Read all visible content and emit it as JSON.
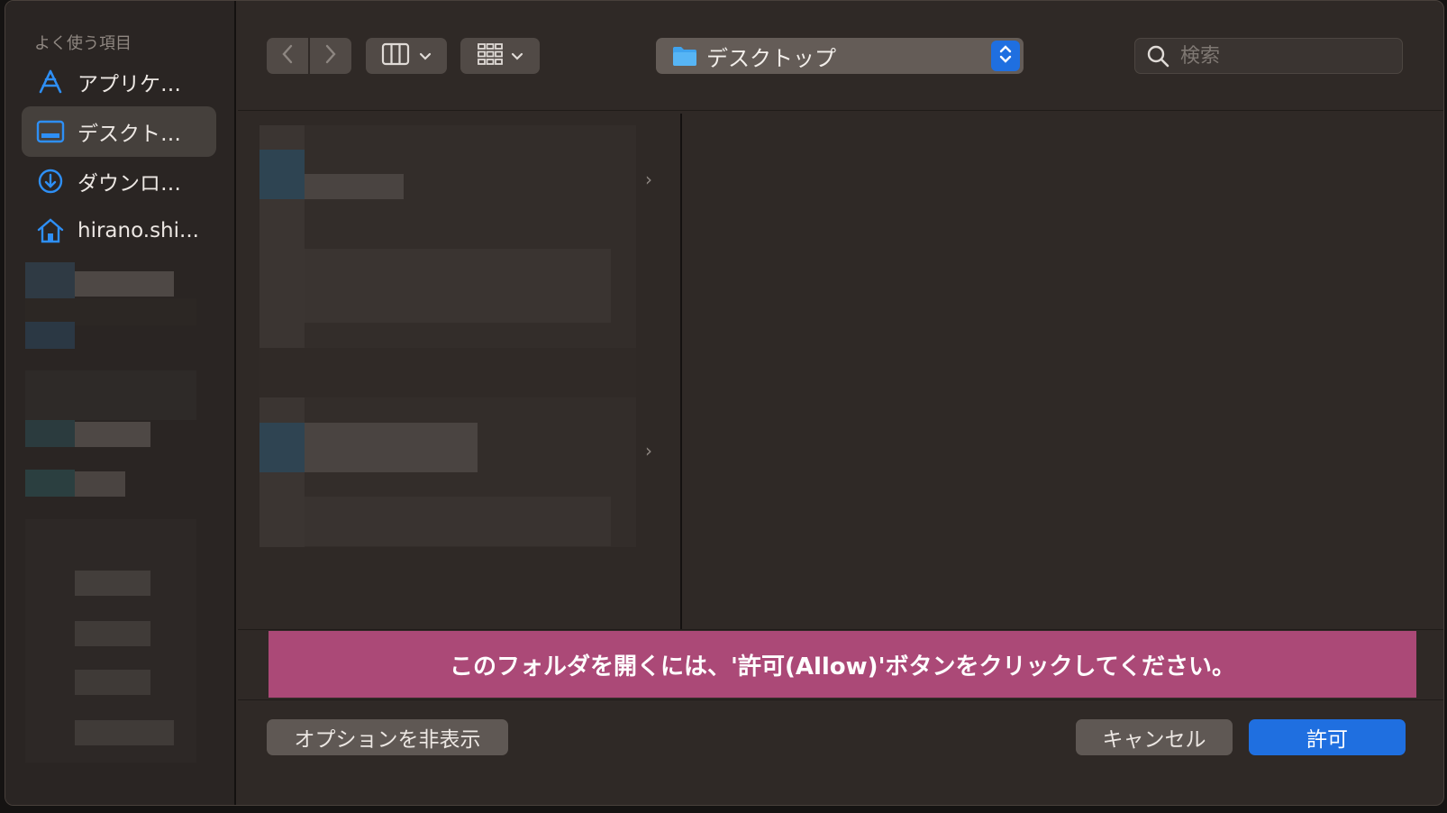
{
  "sidebar": {
    "heading": "よく使う項目",
    "items": [
      {
        "label": "アプリケ…",
        "icon": "applications-icon"
      },
      {
        "label": "デスクト…",
        "icon": "desktop-icon",
        "selected": true
      },
      {
        "label": "ダウンロ…",
        "icon": "downloads-icon"
      },
      {
        "label": "hirano.shi...",
        "icon": "home-icon"
      }
    ]
  },
  "toolbar": {
    "back_icon": "chevron-left-icon",
    "forward_icon": "chevron-right-icon",
    "view_icon": "column-view-icon",
    "group_icon": "grid-view-icon",
    "location": "デスクトップ",
    "search_placeholder": "検索"
  },
  "banner": {
    "message": "このフォルダを開くには、'許可(Allow)'ボタンをクリックしてください。"
  },
  "footer": {
    "options_label": "オプションを非表示",
    "cancel_label": "キャンセル",
    "allow_label": "許可"
  },
  "colors": {
    "accent": "#1f6fe0",
    "banner": "#ab4977",
    "window_bg": "#2f2926",
    "sidebar_bg": "#2a2523"
  }
}
